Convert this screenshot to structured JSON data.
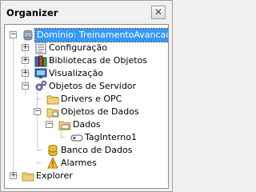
{
  "panel": {
    "title": "Organizer",
    "close_glyph": "✕"
  },
  "tree": {
    "items": [
      {
        "label": "Domínio: TreinamentoAvancado",
        "icon": "domain-icon",
        "expander": "−"
      },
      {
        "label": "Configuração",
        "icon": "configuration-icon",
        "expander": "+"
      },
      {
        "label": "Bibliotecas de Objetos",
        "icon": "library-icon",
        "expander": "+"
      },
      {
        "label": "Visualização",
        "icon": "screen-icon",
        "expander": "+"
      },
      {
        "label": "Objetos de Servidor",
        "icon": "server-objects-icon",
        "expander": "−"
      },
      {
        "label": "Drivers e OPC",
        "icon": "folder-icon"
      },
      {
        "label": "Objetos de Dados",
        "icon": "folder-icon",
        "expander": "−"
      },
      {
        "label": "Dados",
        "icon": "data-folder-icon",
        "expander": "−"
      },
      {
        "label": "TagInterno1",
        "icon": "tag-icon"
      },
      {
        "label": "Banco de Dados",
        "icon": "database-icon"
      },
      {
        "label": "Alarmes",
        "icon": "alarm-icon"
      },
      {
        "label": "Explorer",
        "icon": "folder-icon",
        "expander": "+"
      }
    ]
  }
}
